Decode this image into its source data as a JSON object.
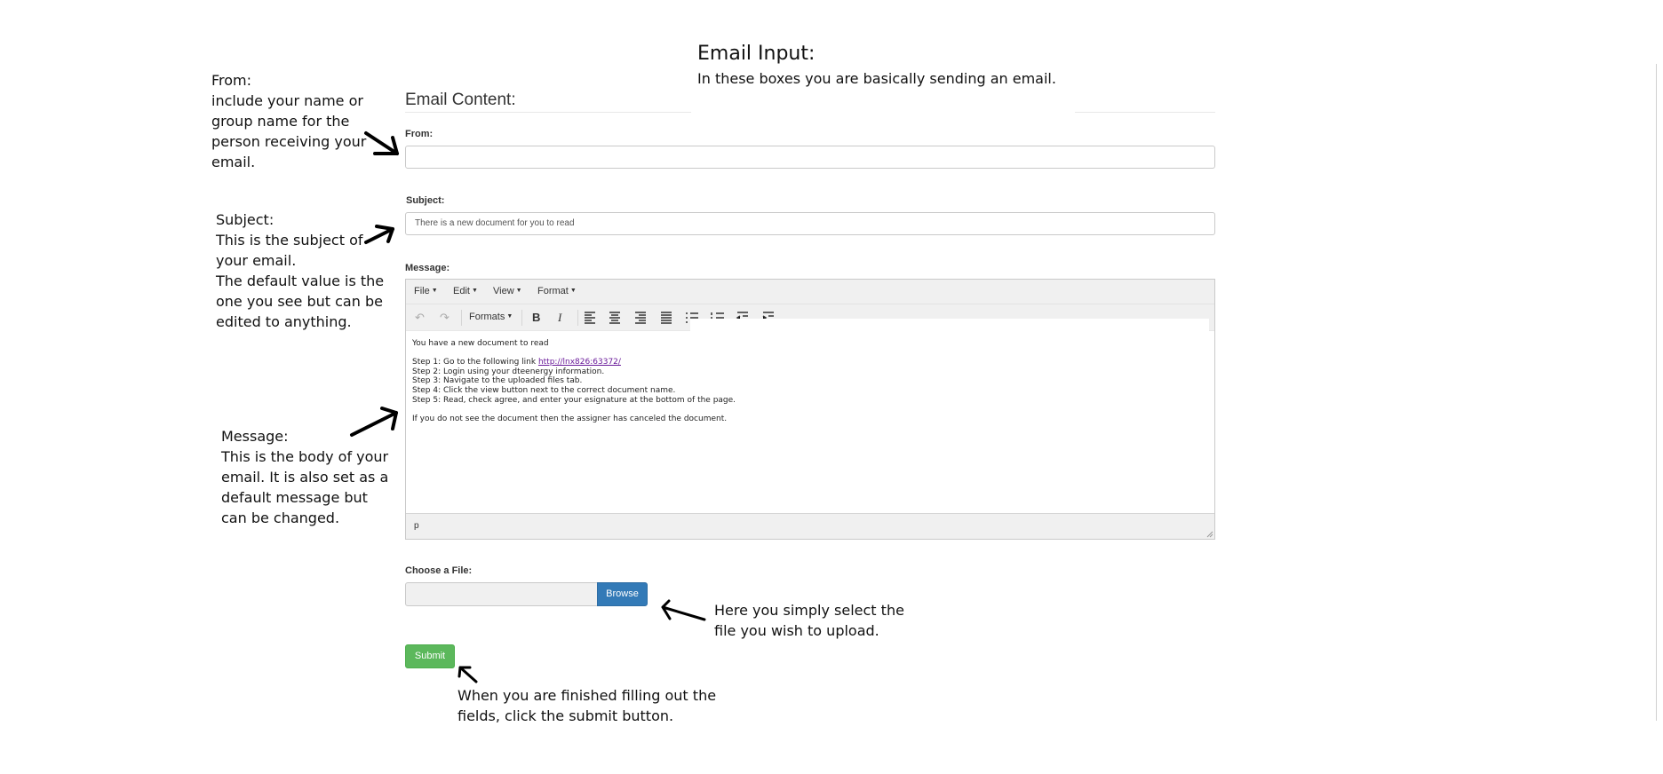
{
  "heading": {
    "title": "Email Input:",
    "subtitle": "In these boxes you are basically sending an email."
  },
  "form": {
    "section_title": "Email Content:",
    "from": {
      "label": "From:",
      "value": ""
    },
    "subject": {
      "label": "Subject:",
      "value": "There is a new document for you to read"
    },
    "message": {
      "label": "Message:",
      "menus": [
        "File",
        "Edit",
        "View",
        "Format"
      ],
      "formats_label": "Formats",
      "bold": "B",
      "italic": "I",
      "status_path": "p",
      "lines": {
        "intro": "You have a new document to read",
        "step1_prefix": "Step 1: Go to the following link ",
        "step1_link": "http://lnx826:63372/",
        "step2": "Step 2: Login using your dteenergy information.",
        "step3": "Step 3: Navigate to the uploaded files tab.",
        "step4": "Step 4: Click the view button next to the correct document name.",
        "step5": "Step 5: Read, check agree, and enter your esignature at the bottom of the page.",
        "outro": "If you do not see the document then the assigner has canceled the document."
      }
    },
    "file": {
      "label": "Choose a File:",
      "browse": "Browse"
    },
    "submit": "Submit"
  },
  "annotations": {
    "from": [
      "From:",
      "include your name or",
      "group name for the",
      "person receiving your",
      "email."
    ],
    "subject": [
      "Subject:",
      "This is the subject of",
      "your email.",
      "The default value is the",
      "one you see but can be",
      "edited to anything."
    ],
    "message": [
      "Message:",
      "This is the body of your",
      "email. It is also set as a",
      "default message but",
      "can be changed."
    ],
    "file": [
      "Here you  simply select the",
      "file you wish to upload."
    ],
    "submit": [
      "When you are finished filling out the",
      "fields, click the submit button."
    ]
  }
}
